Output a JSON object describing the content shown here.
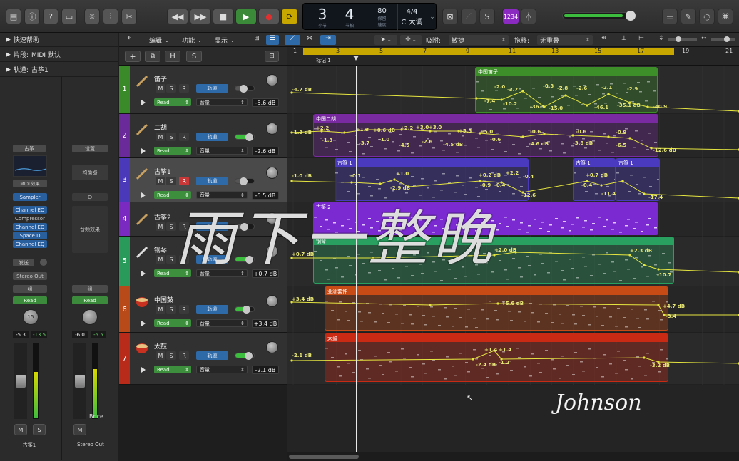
{
  "transport": {
    "bars": "3",
    "beats": "4",
    "bars_caption": "小节",
    "beats_caption": "节拍",
    "tempo": "80",
    "tempo_caption": "保留",
    "tempo_caption2": "速度",
    "signature": "4/4",
    "key": "C 大调",
    "count_in": "1234"
  },
  "inspector": {
    "quick_help": "快速帮助",
    "region_label": "片段:",
    "region_value": "MIDI 默认",
    "track_label": "轨道:",
    "track_value": "古筝1",
    "strip1": {
      "setting": "古筝",
      "midi_fx": "MIDI 效果",
      "instrument": "Sampler",
      "plugins": [
        "Channel EQ",
        "Compressor",
        "Channel EQ",
        "Space D",
        "Channel EQ"
      ],
      "send": "发送",
      "output": "Stereo Out",
      "group": "组",
      "automation": "Read",
      "pan_value": "15",
      "vol_left": "-5.3",
      "vol_right": "-13.5",
      "mute": "M",
      "solo": "S",
      "name": "古筝1"
    },
    "strip2": {
      "setting": "设置",
      "eq": "均衡器",
      "audio_fx": "音频效果",
      "group": "组",
      "automation": "Read",
      "vol_left": "-6.0",
      "vol_right": "-5.5",
      "bounce": "Bnce",
      "mute": "M",
      "name": "Stereo Out"
    }
  },
  "arrange_toolbar": {
    "edit": "编辑",
    "function": "功能",
    "view": "显示",
    "snap_label": "吸附:",
    "snap_value": "敏捷",
    "drag_label": "拖移:",
    "drag_value": "无重叠"
  },
  "header_buttons": {
    "add": "+",
    "h": "H",
    "s": "S"
  },
  "ruler": {
    "bars": [
      "1",
      "3",
      "5",
      "7",
      "9",
      "11",
      "13",
      "15",
      "17",
      "19",
      "21"
    ],
    "marker": "标记 1"
  },
  "tracks": [
    {
      "num": "1",
      "name": "笛子",
      "color": "#3a8a2a",
      "automation": "Read",
      "param": "音量",
      "db": "-5.6 dB",
      "track_btn": "轨道",
      "m": "M",
      "s": "S",
      "r": "R",
      "rec_on": false
    },
    {
      "num": "2",
      "name": "二胡",
      "color": "#6a2a9a",
      "automation": "Read",
      "param": "音量",
      "db": "-2.6 dB",
      "track_btn": "轨道",
      "m": "M",
      "s": "S",
      "r": "R",
      "rec_on": false
    },
    {
      "num": "3",
      "name": "古筝1",
      "color": "#4a3aba",
      "automation": "Read",
      "param": "音量",
      "db": "-5.5 dB",
      "track_btn": "轨道",
      "m": "M",
      "s": "S",
      "r": "R",
      "rec_on": true
    },
    {
      "num": "4",
      "name": "古筝2",
      "color": "#7a2ac0",
      "automation": "",
      "param": "",
      "db": "",
      "track_btn": "轨道",
      "m": "M",
      "s": "S",
      "r": "R",
      "rec_on": false
    },
    {
      "num": "5",
      "name": "钢琴",
      "color": "#2a9a5a",
      "automation": "Read",
      "param": "音量",
      "db": "+0.7 dB",
      "track_btn": "轨道",
      "m": "M",
      "s": "S",
      "r": "R",
      "rec_on": false
    },
    {
      "num": "6",
      "name": "中国鼓",
      "color": "#b84a1a",
      "automation": "Read",
      "param": "音量",
      "db": "+3.4 dB",
      "track_btn": "轨道",
      "m": "M",
      "s": "S",
      "r": "R",
      "rec_on": false
    },
    {
      "num": "7",
      "name": "太鼓",
      "color": "#b82a1a",
      "automation": "Read",
      "param": "音量",
      "db": "-2.1 dB",
      "track_btn": "轨道",
      "m": "M",
      "s": "S",
      "r": "R",
      "rec_on": false
    }
  ],
  "regions": [
    {
      "track": 1,
      "name": "中国笛子",
      "color": "#3d8f2a"
    },
    {
      "track": 2,
      "name": "中国二胡",
      "color": "#7a2aa0"
    },
    {
      "track": 3,
      "name": "古筝 1",
      "color": "#4a3ac0"
    },
    {
      "track": 3,
      "name": "古筝 1",
      "color": "#4a3ac0"
    },
    {
      "track": 3,
      "name": "古筝 1",
      "color": "#4a3ac0"
    },
    {
      "track": 4,
      "name": "古筝 2",
      "color": "#7a2ad0"
    },
    {
      "track": 5,
      "name": "钢琴",
      "color": "#2aa060"
    },
    {
      "track": 6,
      "name": "亚洲套件",
      "color": "#c84a14"
    },
    {
      "track": 7,
      "name": "太鼓",
      "color": "#c82a14"
    }
  ],
  "automation_labels": {
    "t1": [
      "-4.7 dB",
      "-2.0",
      "-3.7",
      "-0.3",
      "-2.8",
      "-2.6",
      "-2.1",
      "-2.9",
      "-7.4",
      "-10.2",
      "-36.3",
      "-15.0",
      "-46.1",
      "-35.1 dB",
      "-40.9"
    ],
    "t2": [
      "-1.3 dB",
      "+2.2",
      "-1.3",
      "+1.3",
      "+0.6 dB",
      "+2.2",
      "+3.0",
      "+3.0",
      "-3.7",
      "-1.0",
      "-4.5",
      "-2.6",
      "-4.5 dB",
      "+5.5",
      "+5.0",
      "-0.6",
      "-0.6",
      "-0.6",
      "-0.9",
      "-4.6 dB",
      "-3.8 dB",
      "-6.5",
      "-12.6 dB"
    ],
    "t3": [
      "-1.0 dB",
      "-0.1",
      "+1.0",
      "-2.9 dB",
      "+0.2 dB",
      "+2.2",
      "-0.4",
      "-0.9",
      "-0.4",
      "-12.6",
      "+0.7 dB",
      "-0.4",
      "-11.4",
      "-17.4"
    ],
    "t5": [
      "+0.7 dB",
      "+2.0 dB",
      "+2.3 dB",
      "-10.7"
    ],
    "t6": [
      "+3.4 dB",
      "+5.6 dB",
      "+4.7 dB",
      "-3.4"
    ],
    "t7": [
      "-2.1 dB",
      "+1.4",
      "+1.4",
      "-2.4 dB",
      "-1.2",
      "-3.2 dB"
    ]
  },
  "overlay_title": "雨下一整晚",
  "signature_text": "Johnson"
}
